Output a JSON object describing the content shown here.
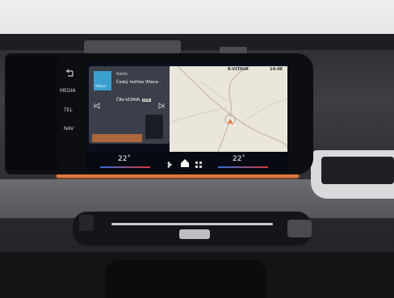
{
  "side_buttons": [
    "MEDIA",
    "TEL",
    "NAV"
  ],
  "status_bar": {
    "radio_station": "R-VLTAVA",
    "time": "14:48"
  },
  "media_widget": {
    "source_label": "Radio",
    "logo_text": "Vltava",
    "now_playing": "Český rozhlas Vltava -",
    "station_name": "ČRo-VLTAVA",
    "badge": "DAB"
  },
  "climate": {
    "left_temp": "22",
    "right_temp": "22",
    "unit": "°"
  },
  "icons": {
    "back": "back-arrow-icon",
    "phone": "phone-icon",
    "navigation": "navigation-arrow-icon",
    "fan": "fan-icon",
    "home": "home-icon",
    "apps": "apps-grid-icon",
    "prev": "skip-previous-icon",
    "next": "skip-next-icon"
  },
  "colors": {
    "accent_orange": "#e07a3a",
    "screen_dark": "#0a0f1c",
    "map_land": "#eae6db",
    "logo_blue": "#3aa0d0"
  }
}
